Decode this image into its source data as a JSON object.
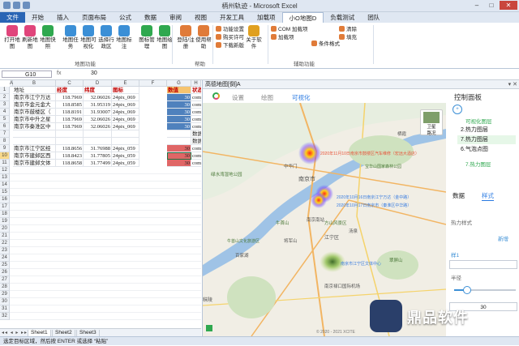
{
  "window": {
    "title": "柄州轨迹 - Microsoft Excel"
  },
  "tabs": [
    "文件",
    "开始",
    "插入",
    "页面布局",
    "公式",
    "数据",
    "审阅",
    "视图",
    "开发工具",
    "加载项",
    "小O地图D",
    "负载测试",
    "团队"
  ],
  "active_tab": "小O地图D",
  "ribbon": {
    "buttons": [
      {
        "label": "打开地图",
        "icon": "open-map-icon",
        "color": "#e0457b"
      },
      {
        "label": "刷新地图",
        "icon": "refresh-map-icon",
        "color": "#e0457b"
      },
      {
        "label": "地图快照",
        "icon": "snapshot-icon",
        "color": "#2fa84f"
      },
      {
        "label": "地图任务",
        "icon": "task-icon",
        "color": "#3b8fd6"
      },
      {
        "label": "地图可视化",
        "icon": "visualize-icon",
        "color": "#3b8fd6"
      },
      {
        "label": "选择行政区",
        "icon": "region-icon",
        "color": "#3b8fd6"
      },
      {
        "label": "地图标注",
        "icon": "marker-icon",
        "color": "#3b8fd6"
      },
      {
        "label": "图标管理",
        "icon": "icon-manage-icon",
        "color": "#2fa84f"
      },
      {
        "label": "地图绘图",
        "icon": "draw-icon",
        "color": "#2fa84f"
      },
      {
        "label": "登陆/注册",
        "icon": "login-icon",
        "color": "#e07b39"
      },
      {
        "label": "使用帮助",
        "icon": "help-icon",
        "color": "#e07b39"
      },
      {
        "label": "关于软件",
        "icon": "about-icon",
        "color": "#e0a020"
      }
    ],
    "small_items": [
      {
        "label": "功能设置",
        "icon": "settings-icon"
      },
      {
        "label": "购买许可",
        "icon": "license-icon"
      },
      {
        "label": "下载新版",
        "icon": "download-icon"
      },
      {
        "label": "COM 加载项",
        "icon": "com-icon"
      },
      {
        "label": "加载项",
        "icon": "addin-icon"
      },
      {
        "label": "条件格式",
        "icon": "conditional-format-icon"
      },
      {
        "label": "清除",
        "icon": "clear-icon"
      },
      {
        "label": "填充",
        "icon": "fill-icon"
      }
    ],
    "groups": [
      "地图功能",
      "帮助",
      "辅助功能"
    ]
  },
  "formula_bar": {
    "name_box": "G10",
    "fx": "fx",
    "value": "30"
  },
  "sheet": {
    "columns": [
      "A",
      "B",
      "C",
      "D",
      "E",
      "F",
      "G",
      "H"
    ],
    "rows": [
      {
        "n": "1",
        "cells": [
          "地址",
          "经度",
          "纬度",
          "图标",
          "数值",
          "状态"
        ]
      },
      {
        "n": "2",
        "cells": [
          "南京市江宁万达",
          "118.7969",
          "32.06026",
          "24pix_069",
          "30",
          "complete"
        ]
      },
      {
        "n": "3",
        "cells": [
          "南京市金元金大",
          "118.8585",
          "31.95319",
          "24pix_069",
          "30",
          "complete"
        ]
      },
      {
        "n": "4",
        "cells": [
          "南京市鼓楼区（",
          "118.8191",
          "31.93007",
          "24pix_069",
          "30",
          "complete"
        ]
      },
      {
        "n": "5",
        "cells": [
          "南京市中升之星",
          "118.7969",
          "32.06026",
          "24pix_069",
          "30",
          "complete"
        ]
      },
      {
        "n": "6",
        "cells": [
          "南京市秦淮区中",
          "118.7969",
          "32.06026",
          "24pix_069",
          "30",
          "complete"
        ]
      },
      {
        "n": "7",
        "cells": [
          "",
          "",
          "",
          "",
          "",
          "数据不合格"
        ]
      },
      {
        "n": "8",
        "cells": [
          "",
          "",
          "",
          "",
          "",
          "数据不合格"
        ]
      },
      {
        "n": "9",
        "cells": [
          "南京市江宁区经",
          "118.8656",
          "31.76988",
          "24pix_059",
          "30",
          "complete"
        ]
      },
      {
        "n": "10",
        "cells": [
          "南京市建邺区西",
          "118.8423",
          "31.77805",
          "24pix_059",
          "30",
          "complete"
        ]
      },
      {
        "n": "11",
        "cells": [
          "南京市建邺文体",
          "118.8658",
          "31.77499",
          "24pix_059",
          "30",
          "complete"
        ]
      }
    ],
    "sheet_tabs": [
      "Sheet1",
      "Sheet2",
      "Sheet3"
    ]
  },
  "status_bar": {
    "text": "选定目标区域，然后按 ENTER 或选择 “粘贴”"
  },
  "map_pane": {
    "title": "高德地图[倒]A",
    "tabs": [
      "设置",
      "绘图",
      "可视化"
    ],
    "active_tab": "可视化",
    "satellite_label": "卫星",
    "road_label": "路况",
    "copyright": "© 2020 - 2021 XCITE",
    "places": [
      "南京市",
      "江宁区",
      "秣陵",
      "南京南站",
      "牛首山",
      "中华门",
      "栖霞",
      "将军山",
      "方山风景区",
      "南京禄口国际机场",
      "南京市江宁区文体中心",
      "汤泉",
      "百家湖",
      "翠屏山",
      "绿水湾湿地公园",
      "宝华山国家森林公园",
      "牛首山文化旅游区"
    ],
    "callouts": [
      "2020年11月10日南京市鼓楼区汽车维修（宏远大酒店）",
      "2020年10月16日南京江宁万达（金中路）",
      "2020年10月17日南京市（秦淮区中华路）"
    ]
  },
  "control_panel": {
    "title": "控制面板",
    "visual_layer_label": "可视化图层",
    "layers": [
      {
        "label": "2.热力图层",
        "active": false
      },
      {
        "label": "7.热力图层",
        "active": true
      },
      {
        "label": "6.气泡点图",
        "active": false
      }
    ],
    "selected_layer_badge": "7.热力图层",
    "sub_tabs": [
      "数据",
      "样式"
    ],
    "active_sub_tab": "样式",
    "style_label": "热力样式",
    "new_label": "新增",
    "style_item": "样1",
    "radius_label": "半径",
    "slider_value": 0.2,
    "stepper_value": "30"
  },
  "watermark": {
    "text": "鼎品软件"
  }
}
